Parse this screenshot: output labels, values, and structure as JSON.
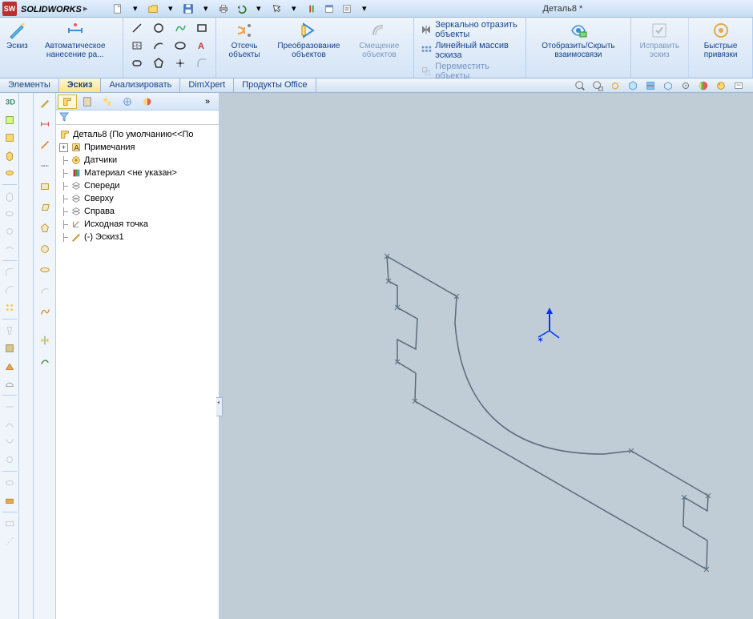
{
  "brand_thin": "SOLID",
  "brand_bold": "WORKS",
  "title": "Деталь8 *",
  "ribbon": {
    "sketch": "Эскиз",
    "autodim": "Автоматическое нанесение ра...",
    "trim": "Отсечь объекты",
    "convert": "Преобразование объектов",
    "offset": "Смещение объектов",
    "mirror": "Зеркально отразить объекты",
    "linear": "Линейный массив эскиза",
    "move": "Переместить объекты",
    "show_hide": "Отобразить/Скрыть взаимосвязи",
    "fix": "Исправить эскиз",
    "quick": "Быстрые привязки"
  },
  "tabs": {
    "features": "Элементы",
    "sketch": "Эскиз",
    "analyze": "Анализировать",
    "dimxpert": "DimXpert",
    "office": "Продукты Office"
  },
  "tree": {
    "root": "Деталь8  (По умолчанию<<По",
    "annotations": "Примечания",
    "sensors": "Датчики",
    "material": "Материал <не указан>",
    "front": "Спереди",
    "top": "Сверху",
    "right": "Справа",
    "origin": "Исходная точка",
    "sketch1": "(-) Эскиз1"
  }
}
